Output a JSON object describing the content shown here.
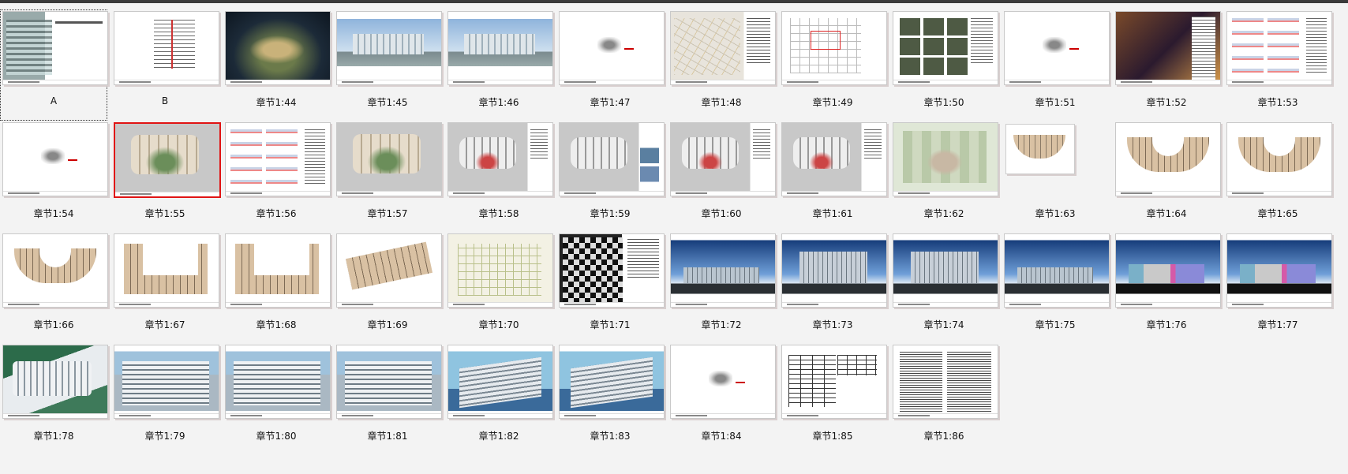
{
  "slides": [
    {
      "label": "A",
      "style": "t-title",
      "state": "focused"
    },
    {
      "label": "B",
      "style": "t-toc"
    },
    {
      "label": "章节1:44",
      "style": "t-night"
    },
    {
      "label": "章节1:45",
      "style": "t-sky"
    },
    {
      "label": "章节1:46",
      "style": "t-sky"
    },
    {
      "label": "章节1:47",
      "style": "t-logo"
    },
    {
      "label": "章节1:48",
      "style": "t-map"
    },
    {
      "label": "章节1:49",
      "style": "t-plan"
    },
    {
      "label": "章节1:50",
      "style": "t-photos"
    },
    {
      "label": "章节1:51",
      "style": "t-logo"
    },
    {
      "label": "章节1:52",
      "style": "t-interior"
    },
    {
      "label": "章节1:53",
      "style": "t-diagrams"
    },
    {
      "label": "章节1:54",
      "style": "t-logo"
    },
    {
      "label": "章节1:55",
      "style": "t-site",
      "state": "selected"
    },
    {
      "label": "章节1:56",
      "style": "t-diagrams"
    },
    {
      "label": "章节1:57",
      "style": "t-site"
    },
    {
      "label": "章节1:58",
      "style": "t-site-side"
    },
    {
      "label": "章节1:59",
      "style": "t-site-photo"
    },
    {
      "label": "章节1:60",
      "style": "t-site-side"
    },
    {
      "label": "章节1:61",
      "style": "t-site-side"
    },
    {
      "label": "章节1:62",
      "style": "t-green"
    },
    {
      "label": "章节1:63",
      "style": "t-floor-sm"
    },
    {
      "label": "章节1:64",
      "style": "t-floor"
    },
    {
      "label": "章节1:65",
      "style": "t-floor"
    },
    {
      "label": "章节1:66",
      "style": "t-floor"
    },
    {
      "label": "章节1:67",
      "style": "t-floorL"
    },
    {
      "label": "章节1:68",
      "style": "t-floorL"
    },
    {
      "label": "章节1:69",
      "style": "t-floorD"
    },
    {
      "label": "章节1:70",
      "style": "t-floorG"
    },
    {
      "label": "章节1:71",
      "style": "t-facade"
    },
    {
      "label": "章节1:72",
      "style": "t-elev"
    },
    {
      "label": "章节1:73",
      "style": "t-elev t-elev-tall"
    },
    {
      "label": "章节1:74",
      "style": "t-elev t-elev-tall"
    },
    {
      "label": "章节1:75",
      "style": "t-elev"
    },
    {
      "label": "章节1:76",
      "style": "t-elev-color"
    },
    {
      "label": "章节1:77",
      "style": "t-elev-color"
    },
    {
      "label": "章节1:78",
      "style": "t-aerial"
    },
    {
      "label": "章节1:79",
      "style": "t-render"
    },
    {
      "label": "章节1:80",
      "style": "t-render"
    },
    {
      "label": "章节1:81",
      "style": "t-render"
    },
    {
      "label": "章节1:82",
      "style": "t-render-b"
    },
    {
      "label": "章节1:83",
      "style": "t-render-b"
    },
    {
      "label": "章节1:84",
      "style": "t-logo"
    },
    {
      "label": "章节1:85",
      "style": "t-table"
    },
    {
      "label": "章节1:86",
      "style": "t-text"
    }
  ]
}
